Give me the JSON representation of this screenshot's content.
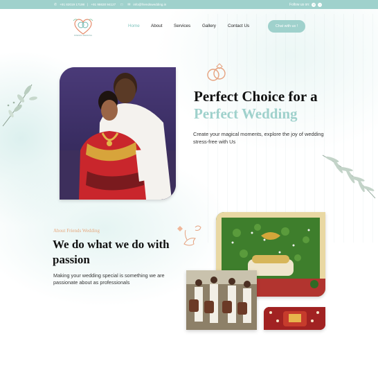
{
  "topbar": {
    "phone1": "+91 82019 17198",
    "phone2": "+91 98630 94127",
    "email": "info@friendswedding.in",
    "follow_label": "Follow us on:"
  },
  "brand": {
    "logo_text": "FRIENDS WEDDING"
  },
  "nav": {
    "items": [
      {
        "label": "Home",
        "active": true
      },
      {
        "label": "About",
        "active": false
      },
      {
        "label": "Services",
        "active": false
      },
      {
        "label": "Gallery",
        "active": false
      },
      {
        "label": "Contact Us",
        "active": false
      }
    ],
    "cta": "Chat with us !"
  },
  "hero": {
    "title_line1": "Perfect Choice for a",
    "title_line2": "Perfect Wedding",
    "subtitle": "Create your magical moments, explore the joy of wedding stress-free with Us"
  },
  "about": {
    "label": "About Friends Wedding",
    "title": "We do what we do with passion",
    "subtitle": "Making your wedding special is something we are passionate about as professionals"
  },
  "icons": {
    "phone": "phone-icon",
    "email": "email-icon",
    "whatsapp": "whatsapp-icon",
    "facebook": "facebook-icon",
    "instagram": "instagram-icon"
  },
  "colors": {
    "accent": "#9fd1cc",
    "about_label": "#e7a87e",
    "text": "#111111"
  }
}
